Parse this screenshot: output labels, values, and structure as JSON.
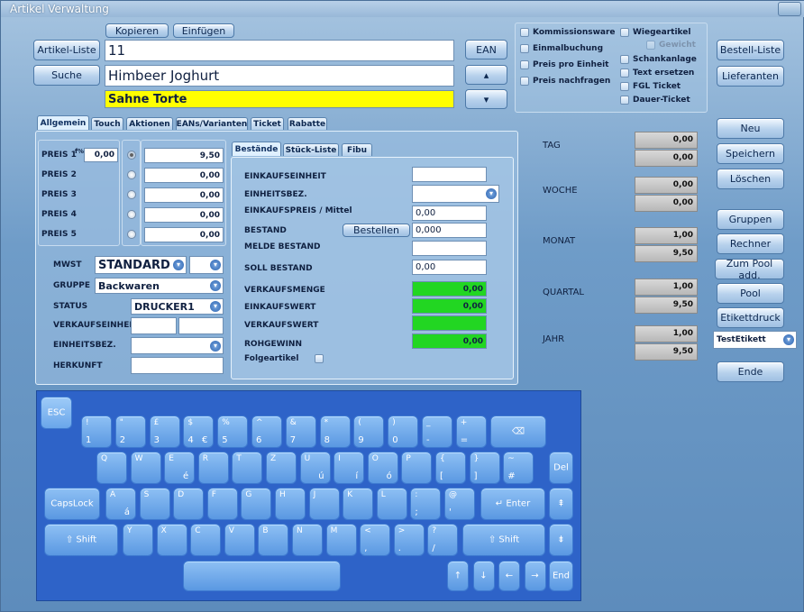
{
  "window": {
    "title": "Artikel Verwaltung"
  },
  "top": {
    "kopieren": "Kopieren",
    "einfuegen": "Einfügen",
    "artikel_liste": "Artikel-Liste",
    "suche": "Suche",
    "ean": "EAN",
    "article_no": "11",
    "article_name": "Himbeer Joghurt",
    "article_desc": "Sahne Torte"
  },
  "options": {
    "kommissionsware": "Kommissionsware",
    "einmalbuchung": "Einmalbuchung",
    "preis_pro_einheit": "Preis pro Einheit",
    "preis_nachfragen": "Preis nachfragen",
    "wiegeartikel": "Wiegeartikel",
    "gewicht": "Gewicht",
    "schankanlage": "Schankanlage",
    "text_ersetzen": "Text ersetzen",
    "fgl_ticket": "FGL Ticket",
    "dauer_ticket": "Dauer-Ticket"
  },
  "right_buttons": {
    "bestell_liste": "Bestell-Liste",
    "lieferanten": "Lieferanten",
    "neu": "Neu",
    "speichern": "Speichern",
    "loeschen": "Löschen",
    "gruppen": "Gruppen",
    "rechner": "Rechner",
    "zum_pool": "Zum Pool add.",
    "pool": "Pool",
    "etikettdruck": "Etikettdruck",
    "etikett_select": "TestEtikett",
    "ende": "Ende"
  },
  "tabs": [
    "Allgemein",
    "Touch",
    "Aktionen",
    "EANs/Varianten",
    "Ticket",
    "Rabatte"
  ],
  "subtabs": [
    "Bestände",
    "Stück-Liste",
    "Fibu"
  ],
  "prices": {
    "labels": [
      "PREIS 1",
      "PREIS 2",
      "PREIS 3",
      "PREIS 4",
      "PREIS 5"
    ],
    "pct_label": "f%",
    "pct_value": "0,00",
    "values": [
      "9,50",
      "0,00",
      "0,00",
      "0,00",
      "0,00"
    ]
  },
  "general": {
    "mwst_label": "MWST",
    "mwst_value": "STANDARD",
    "gruppe_label": "GRUPPE",
    "gruppe_value": "Backwaren",
    "status_label": "STATUS",
    "status_value": "DRUCKER1",
    "verkaufseinheit_label": "VERKAUFSEINHEIT",
    "einheitsbez_label": "EINHEITSBEZ.",
    "herkunft_label": "HERKUNFT"
  },
  "bestaende": {
    "einkaufseinheit": "EINKAUFSEINHEIT",
    "einheitsbez": "EINHEITSBEZ.",
    "einkaufspreis": "EINKAUFSPREIS / Mittel",
    "einkaufspreis_value": "0,00",
    "bestand": "BESTAND",
    "bestellen": "Bestellen",
    "bestand_value": "0,000",
    "melde_bestand": "MELDE BESTAND",
    "soll_bestand": "SOLL BESTAND",
    "soll_bestand_value": "0,00",
    "verkaufsmenge": "VERKAUFSMENGE",
    "verkaufsmenge_value": "0,00",
    "einkaufswert": "EINKAUFSWERT",
    "einkaufswert_value": "0,00",
    "verkaufswert": "VERKAUFSWERT",
    "rohgewinn": "ROHGEWINN",
    "rohgewinn_value": "0,00",
    "folgeartikel": "Folgeartikel"
  },
  "stats": [
    {
      "label": "TAG",
      "v1": "0,00",
      "v2": "0,00"
    },
    {
      "label": "WOCHE",
      "v1": "0,00",
      "v2": "0,00"
    },
    {
      "label": "MONAT",
      "v1": "1,00",
      "v2": "9,50"
    },
    {
      "label": "QUARTAL",
      "v1": "1,00",
      "v2": "9,50"
    },
    {
      "label": "JAHR",
      "v1": "1,00",
      "v2": "9,50"
    }
  ],
  "keyboard": {
    "esc": "ESC",
    "caps": "CapsLock",
    "shift": "Shift",
    "enter": "Enter",
    "del": "Del",
    "end": "End",
    "row1": [
      {
        "t": "!",
        "b": "1"
      },
      {
        "t": "\"",
        "b": "2"
      },
      {
        "t": "£",
        "b": "3"
      },
      {
        "t": "$",
        "b": "4",
        "r": "€"
      },
      {
        "t": "%",
        "b": "5"
      },
      {
        "t": "^",
        "b": "6"
      },
      {
        "t": "&",
        "b": "7"
      },
      {
        "t": "*",
        "b": "8"
      },
      {
        "t": "(",
        "b": "9"
      },
      {
        "t": ")",
        "b": "0"
      },
      {
        "t": "_",
        "b": "-"
      },
      {
        "t": "+",
        "b": "="
      }
    ],
    "row2": [
      {
        "t": "Q",
        "b": ""
      },
      {
        "t": "W",
        "b": ""
      },
      {
        "t": "E",
        "b": "",
        "r": "é"
      },
      {
        "t": "R",
        "b": ""
      },
      {
        "t": "T",
        "b": ""
      },
      {
        "t": "Z",
        "b": ""
      },
      {
        "t": "U",
        "b": "",
        "r": "ú"
      },
      {
        "t": "I",
        "b": "",
        "r": "í"
      },
      {
        "t": "O",
        "b": "",
        "r": "ó"
      },
      {
        "t": "P",
        "b": ""
      },
      {
        "t": "{",
        "b": "["
      },
      {
        "t": "}",
        "b": "]"
      },
      {
        "t": "~",
        "b": "#"
      }
    ],
    "row3": [
      {
        "t": "A",
        "b": "",
        "r": "á"
      },
      {
        "t": "S",
        "b": ""
      },
      {
        "t": "D",
        "b": ""
      },
      {
        "t": "F",
        "b": ""
      },
      {
        "t": "G",
        "b": ""
      },
      {
        "t": "H",
        "b": ""
      },
      {
        "t": "J",
        "b": ""
      },
      {
        "t": "K",
        "b": ""
      },
      {
        "t": "L",
        "b": ""
      },
      {
        "t": ":",
        "b": ";"
      },
      {
        "t": "@",
        "b": "'"
      }
    ],
    "row4": [
      {
        "t": "Y",
        "b": ""
      },
      {
        "t": "X",
        "b": ""
      },
      {
        "t": "C",
        "b": ""
      },
      {
        "t": "V",
        "b": ""
      },
      {
        "t": "B",
        "b": ""
      },
      {
        "t": "N",
        "b": ""
      },
      {
        "t": "M",
        "b": ""
      },
      {
        "t": "<",
        "b": ","
      },
      {
        "t": ">",
        "b": "."
      },
      {
        "t": "?",
        "b": "/"
      }
    ],
    "arrows": [
      "↑",
      "↓",
      "←",
      "→"
    ]
  },
  "colors": {
    "accent": "#2e63c8",
    "highlight_yellow": "#ffff00",
    "stat_green": "#22d622"
  }
}
